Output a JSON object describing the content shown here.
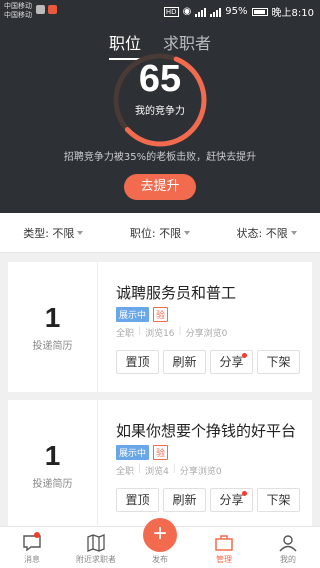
{
  "status_bar": {
    "carrier1": "中国移动",
    "carrier2": "中国移动",
    "hd": "HD",
    "battery": "95%",
    "time": "晚上8:10"
  },
  "header": {
    "tabs": [
      {
        "label": "职位",
        "active": true
      },
      {
        "label": "求职者",
        "active": false
      }
    ],
    "score": "65",
    "score_label": "我的竞争力",
    "score_fraction": 0.65,
    "tip": "招聘竞争力被35%的老板击败，赶快去提升",
    "boost_label": "去提升"
  },
  "filters": {
    "type": "类型: 不限",
    "position": "职位: 不限",
    "status": "状态: 不限"
  },
  "jobs": [
    {
      "count": "1",
      "count_label": "投递简历",
      "title": "诚聘服务员和普工",
      "badge_status": "展示中",
      "badge_verify": "验",
      "stat_scope": "全职",
      "stat_views": "浏览16",
      "stat_shares": "分享浏览0",
      "actions": {
        "top": "置顶",
        "refresh": "刷新",
        "share": "分享",
        "remove": "下架"
      }
    },
    {
      "count": "1",
      "count_label": "投递简历",
      "title": "如果你想要个挣钱的好平台",
      "badge_status": "展示中",
      "badge_verify": "验",
      "stat_scope": "全职",
      "stat_views": "浏览4",
      "stat_shares": "分享浏览0",
      "actions": {
        "top": "置顶",
        "refresh": "刷新",
        "share": "分享",
        "remove": "下架"
      }
    }
  ],
  "nav": {
    "messages": "消息",
    "nearby": "附近求职者",
    "publish": "发布",
    "manage": "管理",
    "mine": "我的"
  },
  "colors": {
    "accent": "#f26b4f",
    "header_bg": "#2d3035",
    "badge_blue": "#6aa7e8"
  }
}
